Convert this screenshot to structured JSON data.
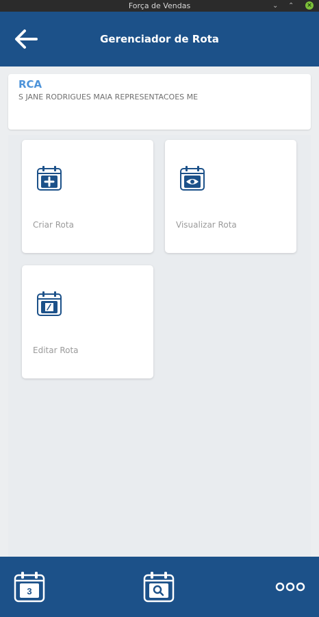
{
  "window": {
    "title": "Força de Vendas"
  },
  "header": {
    "title": "Gerenciador de Rota"
  },
  "rca": {
    "label": "RCA",
    "name": "S JANE RODRIGUES MAIA REPRESENTACOES ME"
  },
  "tiles": [
    {
      "label": "Criar Rota",
      "icon": "calendar-plus-icon"
    },
    {
      "label": "Visualizar Rota",
      "icon": "calendar-eye-icon"
    },
    {
      "label": "Editar Rota",
      "icon": "calendar-edit-icon"
    }
  ],
  "bottom_nav": {
    "calendar_day": "3",
    "items": [
      "calendar-day-icon",
      "calendar-search-icon",
      "more-icon"
    ]
  },
  "colors": {
    "primary": "#1c5189",
    "accent": "#4d93d9",
    "background": "#eceef0",
    "label_gray": "#9a9a9a"
  }
}
